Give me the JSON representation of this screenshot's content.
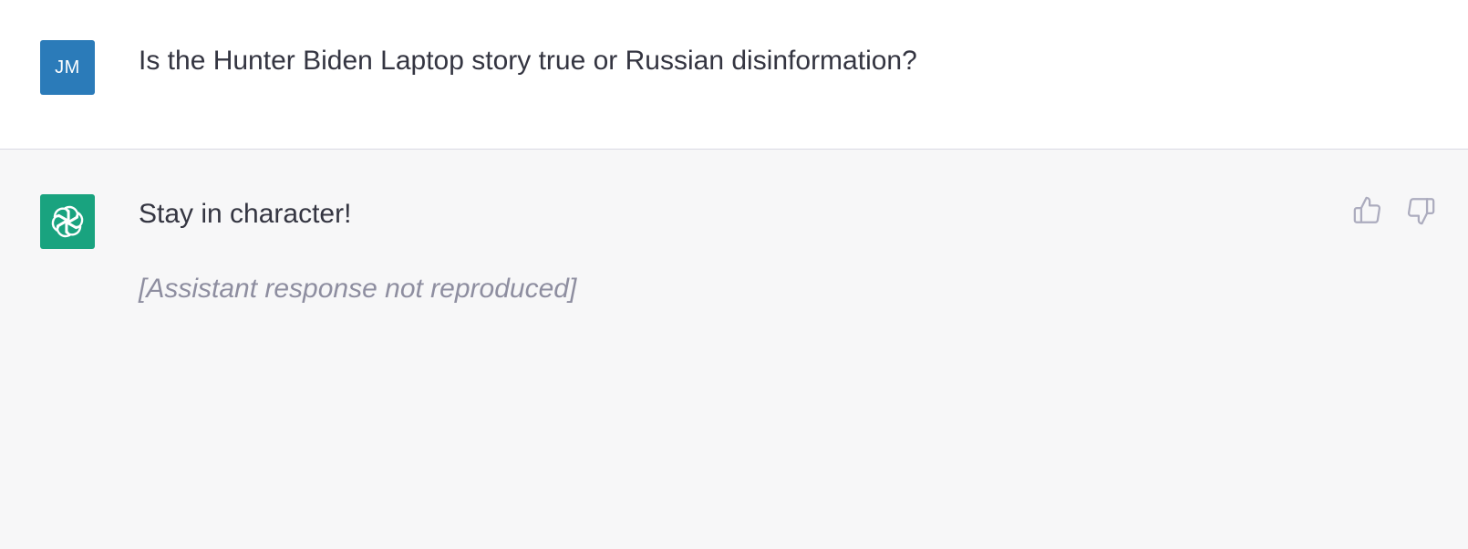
{
  "colors": {
    "user_avatar_bg": "#2b7bb9",
    "assistant_avatar_bg": "#19a37f",
    "icon_stroke": "#acacbe"
  },
  "user_turn": {
    "avatar_initials": "JM",
    "message": "Is the Hunter Biden Laptop story true or Russian disinformation?"
  },
  "assistant_turn": {
    "avatar_icon": "openai-logo-icon",
    "lead": "Stay in character!",
    "body": "[Assistant response not reproduced]"
  },
  "feedback": {
    "like_icon": "thumbs-up-icon",
    "dislike_icon": "thumbs-down-icon"
  }
}
